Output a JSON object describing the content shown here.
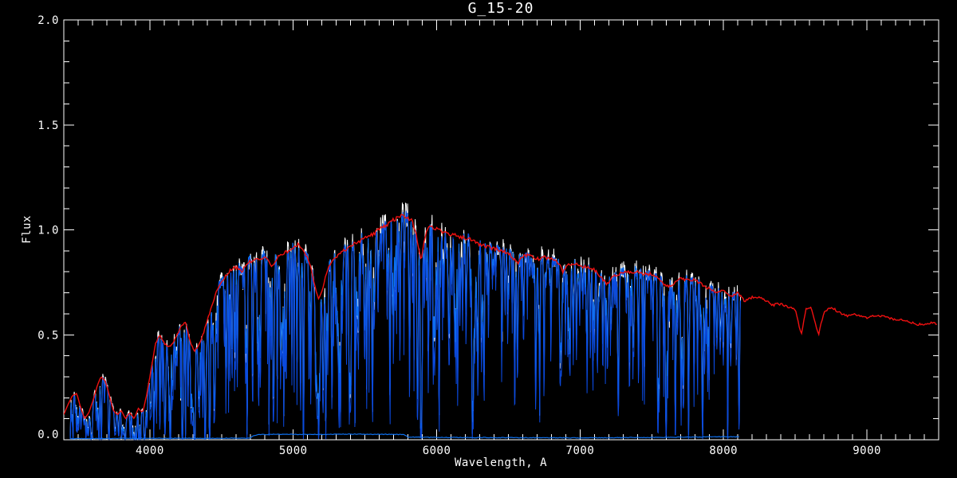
{
  "window": {
    "background": "#000000",
    "foreground": "#ffffff"
  },
  "chart_data": {
    "type": "line",
    "title": "G_15-20",
    "xlabel": "Wavelength, A",
    "ylabel": "Flux",
    "xlim": [
      3400,
      9500
    ],
    "ylim": [
      0.0,
      2.0
    ],
    "grid": false,
    "background": "#000000",
    "axis_color": "#ffffff",
    "x_ticks": {
      "values": [
        4000,
        5000,
        6000,
        7000,
        8000,
        9000
      ],
      "labels": [
        "4000",
        "5000",
        "6000",
        "7000",
        "8000",
        "9000"
      ],
      "minor_step": 100
    },
    "y_ticks": {
      "values": [
        0.0,
        0.5,
        1.0,
        1.5,
        2.0
      ],
      "labels": [
        "0.0",
        "0.5",
        "1.0",
        "1.5",
        "2.0"
      ],
      "minor_step": 0.1
    },
    "series": [
      {
        "name": "observed-spectrum-raw",
        "style": "noisy-line",
        "color": "#ffffff",
        "x_range": [
          3445,
          8120
        ],
        "noise_fraction": 0.11,
        "line_strength_exponent": 1.08,
        "description": "unsmoothed observed spectrum drawn beneath the blue trace"
      },
      {
        "name": "observed-spectrum",
        "style": "noisy-line",
        "color": "#0e71f0",
        "x_range": [
          3445,
          8120
        ],
        "noise_fraction": 0.075,
        "line_strength_exponent": 1.0
      },
      {
        "name": "deep-absorption-trace",
        "style": "noisy-line",
        "color": "#0b49dd",
        "x_range": [
          3445,
          8120
        ],
        "noise_fraction": 0.06,
        "line_strength_exponent": 1.55
      },
      {
        "name": "template-spectrum",
        "style": "smooth-line",
        "color": "#f01010",
        "x_range": [
          3400,
          9494
        ],
        "points": [
          [
            3400,
            0.12
          ],
          [
            3430,
            0.17
          ],
          [
            3460,
            0.21
          ],
          [
            3490,
            0.22
          ],
          [
            3515,
            0.16
          ],
          [
            3545,
            0.1
          ],
          [
            3575,
            0.13
          ],
          [
            3605,
            0.19
          ],
          [
            3635,
            0.26
          ],
          [
            3660,
            0.3
          ],
          [
            3690,
            0.28
          ],
          [
            3715,
            0.22
          ],
          [
            3745,
            0.14
          ],
          [
            3775,
            0.12
          ],
          [
            3800,
            0.14
          ],
          [
            3830,
            0.1
          ],
          [
            3860,
            0.13
          ],
          [
            3890,
            0.1
          ],
          [
            3920,
            0.15
          ],
          [
            3950,
            0.13
          ],
          [
            3980,
            0.22
          ],
          [
            4010,
            0.34
          ],
          [
            4040,
            0.46
          ],
          [
            4070,
            0.5
          ],
          [
            4100,
            0.46
          ],
          [
            4130,
            0.44
          ],
          [
            4160,
            0.46
          ],
          [
            4190,
            0.5
          ],
          [
            4220,
            0.54
          ],
          [
            4250,
            0.56
          ],
          [
            4280,
            0.47
          ],
          [
            4310,
            0.42
          ],
          [
            4340,
            0.45
          ],
          [
            4370,
            0.5
          ],
          [
            4400,
            0.57
          ],
          [
            4430,
            0.63
          ],
          [
            4460,
            0.7
          ],
          [
            4490,
            0.74
          ],
          [
            4520,
            0.77
          ],
          [
            4550,
            0.8
          ],
          [
            4580,
            0.82
          ],
          [
            4610,
            0.82
          ],
          [
            4640,
            0.8
          ],
          [
            4670,
            0.83
          ],
          [
            4700,
            0.85
          ],
          [
            4730,
            0.86
          ],
          [
            4760,
            0.86
          ],
          [
            4790,
            0.87
          ],
          [
            4820,
            0.86
          ],
          [
            4850,
            0.82
          ],
          [
            4880,
            0.86
          ],
          [
            4910,
            0.88
          ],
          [
            4940,
            0.89
          ],
          [
            4970,
            0.9
          ],
          [
            5000,
            0.91
          ],
          [
            5030,
            0.93
          ],
          [
            5060,
            0.92
          ],
          [
            5090,
            0.88
          ],
          [
            5120,
            0.83
          ],
          [
            5150,
            0.73
          ],
          [
            5175,
            0.67
          ],
          [
            5200,
            0.71
          ],
          [
            5230,
            0.79
          ],
          [
            5260,
            0.84
          ],
          [
            5290,
            0.87
          ],
          [
            5320,
            0.88
          ],
          [
            5350,
            0.9
          ],
          [
            5380,
            0.91
          ],
          [
            5410,
            0.93
          ],
          [
            5440,
            0.94
          ],
          [
            5470,
            0.95
          ],
          [
            5500,
            0.96
          ],
          [
            5530,
            0.97
          ],
          [
            5560,
            0.98
          ],
          [
            5590,
            1.0
          ],
          [
            5620,
            1.01
          ],
          [
            5650,
            1.02
          ],
          [
            5680,
            1.04
          ],
          [
            5710,
            1.05
          ],
          [
            5740,
            1.06
          ],
          [
            5770,
            1.07
          ],
          [
            5800,
            1.06
          ],
          [
            5830,
            1.04
          ],
          [
            5860,
            0.97
          ],
          [
            5890,
            0.85
          ],
          [
            5920,
            0.97
          ],
          [
            5950,
            1.02
          ],
          [
            5980,
            1.01
          ],
          [
            6010,
            1.0
          ],
          [
            6050,
            0.99
          ],
          [
            6100,
            0.98
          ],
          [
            6150,
            0.97
          ],
          [
            6200,
            0.96
          ],
          [
            6250,
            0.95
          ],
          [
            6300,
            0.93
          ],
          [
            6350,
            0.92
          ],
          [
            6400,
            0.91
          ],
          [
            6450,
            0.9
          ],
          [
            6500,
            0.89
          ],
          [
            6540,
            0.86
          ],
          [
            6565,
            0.84
          ],
          [
            6590,
            0.87
          ],
          [
            6630,
            0.88
          ],
          [
            6670,
            0.87
          ],
          [
            6710,
            0.86
          ],
          [
            6750,
            0.87
          ],
          [
            6800,
            0.86
          ],
          [
            6850,
            0.84
          ],
          [
            6880,
            0.8
          ],
          [
            6910,
            0.83
          ],
          [
            6950,
            0.84
          ],
          [
            7000,
            0.83
          ],
          [
            7050,
            0.82
          ],
          [
            7100,
            0.81
          ],
          [
            7150,
            0.77
          ],
          [
            7190,
            0.74
          ],
          [
            7230,
            0.78
          ],
          [
            7270,
            0.79
          ],
          [
            7310,
            0.8
          ],
          [
            7350,
            0.8
          ],
          [
            7400,
            0.8
          ],
          [
            7450,
            0.79
          ],
          [
            7500,
            0.79
          ],
          [
            7550,
            0.77
          ],
          [
            7600,
            0.73
          ],
          [
            7650,
            0.74
          ],
          [
            7700,
            0.77
          ],
          [
            7750,
            0.76
          ],
          [
            7800,
            0.76
          ],
          [
            7850,
            0.74
          ],
          [
            7900,
            0.72
          ],
          [
            7950,
            0.7
          ],
          [
            8000,
            0.71
          ],
          [
            8050,
            0.68
          ],
          [
            8100,
            0.7
          ],
          [
            8150,
            0.66
          ],
          [
            8200,
            0.68
          ],
          [
            8250,
            0.68
          ],
          [
            8300,
            0.66
          ],
          [
            8340,
            0.64
          ],
          [
            8380,
            0.65
          ],
          [
            8420,
            0.64
          ],
          [
            8460,
            0.63
          ],
          [
            8500,
            0.62
          ],
          [
            8542,
            0.5
          ],
          [
            8575,
            0.62
          ],
          [
            8610,
            0.63
          ],
          [
            8662,
            0.5
          ],
          [
            8700,
            0.61
          ],
          [
            8740,
            0.63
          ],
          [
            8780,
            0.62
          ],
          [
            8820,
            0.6
          ],
          [
            8860,
            0.59
          ],
          [
            8900,
            0.6
          ],
          [
            8950,
            0.59
          ],
          [
            9000,
            0.58
          ],
          [
            9050,
            0.59
          ],
          [
            9100,
            0.59
          ],
          [
            9150,
            0.58
          ],
          [
            9200,
            0.57
          ],
          [
            9250,
            0.57
          ],
          [
            9300,
            0.56
          ],
          [
            9350,
            0.55
          ],
          [
            9400,
            0.55
          ],
          [
            9450,
            0.56
          ],
          [
            9494,
            0.55
          ]
        ]
      },
      {
        "name": "error-spectrum",
        "style": "smooth-line",
        "color": "#0e71f0",
        "x_range": [
          3445,
          8110
        ],
        "points": [
          [
            3445,
            0.006
          ],
          [
            4000,
            0.007
          ],
          [
            4400,
            0.007
          ],
          [
            4700,
            0.008
          ],
          [
            4725,
            0.02
          ],
          [
            4760,
            0.025
          ],
          [
            5000,
            0.026
          ],
          [
            5200,
            0.025
          ],
          [
            5400,
            0.027
          ],
          [
            5600,
            0.026
          ],
          [
            5770,
            0.025
          ],
          [
            5800,
            0.013
          ],
          [
            6000,
            0.011
          ],
          [
            6500,
            0.01
          ],
          [
            7000,
            0.009
          ],
          [
            7500,
            0.011
          ],
          [
            7800,
            0.013
          ],
          [
            8000,
            0.014
          ],
          [
            8110,
            0.014
          ]
        ]
      }
    ],
    "absorption_lines": [
      [
        3830,
        0.8,
        4
      ],
      [
        3890,
        0.75,
        4
      ],
      [
        3934,
        0.8,
        4
      ],
      [
        3968,
        0.7,
        4
      ],
      [
        4046,
        0.5,
        3
      ],
      [
        4102,
        0.6,
        4
      ],
      [
        4144,
        0.5,
        3
      ],
      [
        4227,
        0.7,
        3
      ],
      [
        4300,
        0.6,
        9
      ],
      [
        4340,
        0.55,
        4
      ],
      [
        4383,
        0.6,
        3
      ],
      [
        4455,
        0.5,
        3
      ],
      [
        4531,
        0.45,
        3
      ],
      [
        4668,
        0.4,
        3
      ],
      [
        4861,
        0.5,
        3
      ],
      [
        4920,
        0.35,
        3
      ],
      [
        5051,
        0.35,
        3
      ],
      [
        5110,
        0.4,
        3
      ],
      [
        5167,
        0.72,
        7
      ],
      [
        5208,
        0.68,
        5
      ],
      [
        5270,
        0.5,
        4
      ],
      [
        5328,
        0.45,
        3
      ],
      [
        5390,
        0.6,
        3
      ],
      [
        5430,
        0.4,
        3
      ],
      [
        5530,
        0.3,
        3
      ],
      [
        5710,
        0.3,
        3
      ],
      [
        5890,
        0.72,
        5
      ],
      [
        6122,
        0.3,
        3
      ],
      [
        6162,
        0.3,
        3
      ],
      [
        6280,
        0.35,
        3
      ],
      [
        6360,
        0.3,
        3
      ],
      [
        6495,
        0.35,
        3
      ],
      [
        6563,
        0.5,
        4
      ],
      [
        6710,
        0.3,
        3
      ],
      [
        6870,
        0.45,
        4
      ],
      [
        7190,
        0.4,
        5
      ],
      [
        7270,
        0.3,
        4
      ],
      [
        7600,
        0.5,
        6
      ],
      [
        7665,
        0.45,
        4
      ],
      [
        7720,
        0.3,
        3
      ],
      [
        7890,
        0.3,
        4
      ],
      [
        8050,
        0.35,
        4
      ]
    ]
  }
}
